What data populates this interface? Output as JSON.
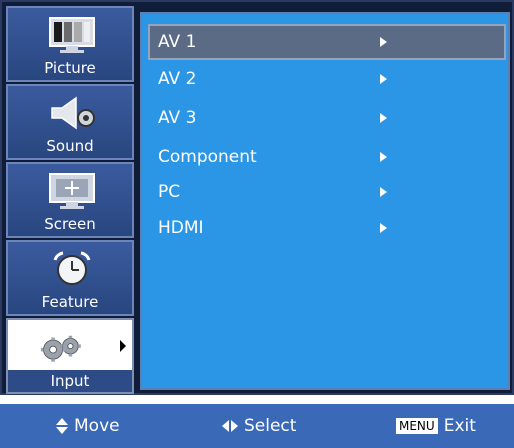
{
  "sidebar": {
    "items": [
      {
        "label": "Picture",
        "icon": "monitor-icon"
      },
      {
        "label": "Sound",
        "icon": "speaker-icon"
      },
      {
        "label": "Screen",
        "icon": "screen-adjust-icon"
      },
      {
        "label": "Feature",
        "icon": "alarm-clock-icon"
      },
      {
        "label": "Input",
        "icon": "gears-icon"
      }
    ]
  },
  "menu": {
    "items": [
      {
        "label": "AV 1"
      },
      {
        "label": "AV 2"
      },
      {
        "label": "AV 3"
      },
      {
        "label": "Component"
      },
      {
        "label": "PC"
      },
      {
        "label": "HDMI"
      }
    ]
  },
  "help": {
    "move": "Move",
    "select": "Select",
    "menu_key": "MENU",
    "exit": "Exit"
  },
  "colors": {
    "frame": "#101d39",
    "panel": "#2b96e6",
    "selected_item": "#5b6b86",
    "help_bar": "#3a6ab7"
  }
}
